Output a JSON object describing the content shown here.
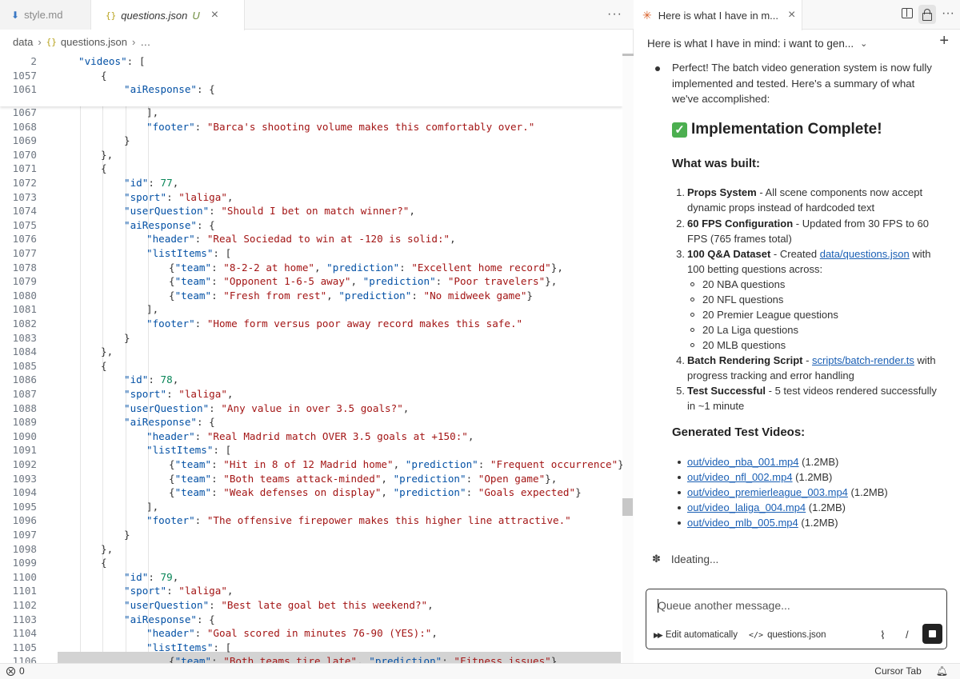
{
  "editor": {
    "tabs": [
      {
        "icon": "markdown-file-icon",
        "title": "style.md"
      },
      {
        "icon": "json-file-icon",
        "glyph": "{}",
        "title": "questions.json",
        "status": "U",
        "close": "×"
      }
    ],
    "more": "···",
    "breadcrumb": {
      "folder": "data",
      "glyph": "{}",
      "file": "questions.json",
      "tail": "…"
    },
    "sticky": [
      {
        "ln": "2",
        "parts": [
          [
            "k",
            "\"videos\""
          ],
          [
            "p",
            ": ["
          ]
        ],
        "indent": 1
      },
      {
        "ln": "1057",
        "parts": [
          [
            "p",
            "{"
          ]
        ],
        "indent": 2
      },
      {
        "ln": "1061",
        "parts": [
          [
            "k",
            "\"aiResponse\""
          ],
          [
            "p",
            ": {"
          ]
        ],
        "indent": 3
      }
    ],
    "lines": [
      {
        "ln": "1067",
        "indent": 4,
        "parts": [
          [
            "p",
            "],"
          ]
        ]
      },
      {
        "ln": "1068",
        "indent": 4,
        "parts": [
          [
            "k",
            "\"footer\""
          ],
          [
            "p",
            ": "
          ],
          [
            "s",
            "\"Barca's shooting volume makes this comfortably over.\""
          ]
        ]
      },
      {
        "ln": "1069",
        "indent": 3,
        "parts": [
          [
            "p",
            "}"
          ]
        ]
      },
      {
        "ln": "1070",
        "indent": 2,
        "parts": [
          [
            "p",
            "},"
          ]
        ]
      },
      {
        "ln": "1071",
        "indent": 2,
        "parts": [
          [
            "p",
            "{"
          ]
        ]
      },
      {
        "ln": "1072",
        "indent": 3,
        "parts": [
          [
            "k",
            "\"id\""
          ],
          [
            "p",
            ": "
          ],
          [
            "n",
            "77"
          ],
          [
            "p",
            ","
          ]
        ]
      },
      {
        "ln": "1073",
        "indent": 3,
        "parts": [
          [
            "k",
            "\"sport\""
          ],
          [
            "p",
            ": "
          ],
          [
            "s",
            "\"laliga\""
          ],
          [
            "p",
            ","
          ]
        ]
      },
      {
        "ln": "1074",
        "indent": 3,
        "parts": [
          [
            "k",
            "\"userQuestion\""
          ],
          [
            "p",
            ": "
          ],
          [
            "s",
            "\"Should I bet on match winner?\""
          ],
          [
            "p",
            ","
          ]
        ]
      },
      {
        "ln": "1075",
        "indent": 3,
        "parts": [
          [
            "k",
            "\"aiResponse\""
          ],
          [
            "p",
            ": {"
          ]
        ]
      },
      {
        "ln": "1076",
        "indent": 4,
        "parts": [
          [
            "k",
            "\"header\""
          ],
          [
            "p",
            ": "
          ],
          [
            "s",
            "\"Real Sociedad to win at -120 is solid:\""
          ],
          [
            "p",
            ","
          ]
        ]
      },
      {
        "ln": "1077",
        "indent": 4,
        "parts": [
          [
            "k",
            "\"listItems\""
          ],
          [
            "p",
            ": ["
          ]
        ]
      },
      {
        "ln": "1078",
        "indent": 5,
        "parts": [
          [
            "p",
            "{"
          ],
          [
            "k",
            "\"team\""
          ],
          [
            "p",
            ": "
          ],
          [
            "s",
            "\"8-2-2 at home\""
          ],
          [
            "p",
            ", "
          ],
          [
            "k",
            "\"prediction\""
          ],
          [
            "p",
            ": "
          ],
          [
            "s",
            "\"Excellent home record\""
          ],
          [
            "p",
            "},"
          ]
        ]
      },
      {
        "ln": "1079",
        "indent": 5,
        "parts": [
          [
            "p",
            "{"
          ],
          [
            "k",
            "\"team\""
          ],
          [
            "p",
            ": "
          ],
          [
            "s",
            "\"Opponent 1-6-5 away\""
          ],
          [
            "p",
            ", "
          ],
          [
            "k",
            "\"prediction\""
          ],
          [
            "p",
            ": "
          ],
          [
            "s",
            "\"Poor travelers\""
          ],
          [
            "p",
            "},"
          ]
        ]
      },
      {
        "ln": "1080",
        "indent": 5,
        "parts": [
          [
            "p",
            "{"
          ],
          [
            "k",
            "\"team\""
          ],
          [
            "p",
            ": "
          ],
          [
            "s",
            "\"Fresh from rest\""
          ],
          [
            "p",
            ", "
          ],
          [
            "k",
            "\"prediction\""
          ],
          [
            "p",
            ": "
          ],
          [
            "s",
            "\"No midweek game\""
          ],
          [
            "p",
            "}"
          ]
        ]
      },
      {
        "ln": "1081",
        "indent": 4,
        "parts": [
          [
            "p",
            "],"
          ]
        ]
      },
      {
        "ln": "1082",
        "indent": 4,
        "parts": [
          [
            "k",
            "\"footer\""
          ],
          [
            "p",
            ": "
          ],
          [
            "s",
            "\"Home form versus poor away record makes this safe.\""
          ]
        ]
      },
      {
        "ln": "1083",
        "indent": 3,
        "parts": [
          [
            "p",
            "}"
          ]
        ]
      },
      {
        "ln": "1084",
        "indent": 2,
        "parts": [
          [
            "p",
            "},"
          ]
        ]
      },
      {
        "ln": "1085",
        "indent": 2,
        "parts": [
          [
            "p",
            "{"
          ]
        ]
      },
      {
        "ln": "1086",
        "indent": 3,
        "parts": [
          [
            "k",
            "\"id\""
          ],
          [
            "p",
            ": "
          ],
          [
            "n",
            "78"
          ],
          [
            "p",
            ","
          ]
        ]
      },
      {
        "ln": "1087",
        "indent": 3,
        "parts": [
          [
            "k",
            "\"sport\""
          ],
          [
            "p",
            ": "
          ],
          [
            "s",
            "\"laliga\""
          ],
          [
            "p",
            ","
          ]
        ]
      },
      {
        "ln": "1088",
        "indent": 3,
        "parts": [
          [
            "k",
            "\"userQuestion\""
          ],
          [
            "p",
            ": "
          ],
          [
            "s",
            "\"Any value in over 3.5 goals?\""
          ],
          [
            "p",
            ","
          ]
        ]
      },
      {
        "ln": "1089",
        "indent": 3,
        "parts": [
          [
            "k",
            "\"aiResponse\""
          ],
          [
            "p",
            ": {"
          ]
        ]
      },
      {
        "ln": "1090",
        "indent": 4,
        "parts": [
          [
            "k",
            "\"header\""
          ],
          [
            "p",
            ": "
          ],
          [
            "s",
            "\"Real Madrid match OVER 3.5 goals at +150:\""
          ],
          [
            "p",
            ","
          ]
        ]
      },
      {
        "ln": "1091",
        "indent": 4,
        "parts": [
          [
            "k",
            "\"listItems\""
          ],
          [
            "p",
            ": ["
          ]
        ]
      },
      {
        "ln": "1092",
        "indent": 5,
        "parts": [
          [
            "p",
            "{"
          ],
          [
            "k",
            "\"team\""
          ],
          [
            "p",
            ": "
          ],
          [
            "s",
            "\"Hit in 8 of 12 Madrid home\""
          ],
          [
            "p",
            ", "
          ],
          [
            "k",
            "\"prediction\""
          ],
          [
            "p",
            ": "
          ],
          [
            "s",
            "\"Frequent occurrence\""
          ],
          [
            "p",
            "},"
          ]
        ]
      },
      {
        "ln": "1093",
        "indent": 5,
        "parts": [
          [
            "p",
            "{"
          ],
          [
            "k",
            "\"team\""
          ],
          [
            "p",
            ": "
          ],
          [
            "s",
            "\"Both teams attack-minded\""
          ],
          [
            "p",
            ", "
          ],
          [
            "k",
            "\"prediction\""
          ],
          [
            "p",
            ": "
          ],
          [
            "s",
            "\"Open game\""
          ],
          [
            "p",
            "},"
          ]
        ]
      },
      {
        "ln": "1094",
        "indent": 5,
        "parts": [
          [
            "p",
            "{"
          ],
          [
            "k",
            "\"team\""
          ],
          [
            "p",
            ": "
          ],
          [
            "s",
            "\"Weak defenses on display\""
          ],
          [
            "p",
            ", "
          ],
          [
            "k",
            "\"prediction\""
          ],
          [
            "p",
            ": "
          ],
          [
            "s",
            "\"Goals expected\""
          ],
          [
            "p",
            "}"
          ]
        ]
      },
      {
        "ln": "1095",
        "indent": 4,
        "parts": [
          [
            "p",
            "],"
          ]
        ]
      },
      {
        "ln": "1096",
        "indent": 4,
        "parts": [
          [
            "k",
            "\"footer\""
          ],
          [
            "p",
            ": "
          ],
          [
            "s",
            "\"The offensive firepower makes this higher line attractive.\""
          ]
        ]
      },
      {
        "ln": "1097",
        "indent": 3,
        "parts": [
          [
            "p",
            "}"
          ]
        ]
      },
      {
        "ln": "1098",
        "indent": 2,
        "parts": [
          [
            "p",
            "},"
          ]
        ]
      },
      {
        "ln": "1099",
        "indent": 2,
        "parts": [
          [
            "p",
            "{"
          ]
        ]
      },
      {
        "ln": "1100",
        "indent": 3,
        "parts": [
          [
            "k",
            "\"id\""
          ],
          [
            "p",
            ": "
          ],
          [
            "n",
            "79"
          ],
          [
            "p",
            ","
          ]
        ]
      },
      {
        "ln": "1101",
        "indent": 3,
        "parts": [
          [
            "k",
            "\"sport\""
          ],
          [
            "p",
            ": "
          ],
          [
            "s",
            "\"laliga\""
          ],
          [
            "p",
            ","
          ]
        ]
      },
      {
        "ln": "1102",
        "indent": 3,
        "parts": [
          [
            "k",
            "\"userQuestion\""
          ],
          [
            "p",
            ": "
          ],
          [
            "s",
            "\"Best late goal bet this weekend?\""
          ],
          [
            "p",
            ","
          ]
        ]
      },
      {
        "ln": "1103",
        "indent": 3,
        "parts": [
          [
            "k",
            "\"aiResponse\""
          ],
          [
            "p",
            ": {"
          ]
        ]
      },
      {
        "ln": "1104",
        "indent": 4,
        "parts": [
          [
            "k",
            "\"header\""
          ],
          [
            "p",
            ": "
          ],
          [
            "s",
            "\"Goal scored in minutes 76-90 (YES):\""
          ],
          [
            "p",
            ","
          ]
        ]
      },
      {
        "ln": "1105",
        "indent": 4,
        "parts": [
          [
            "k",
            "\"listItems\""
          ],
          [
            "p",
            ": ["
          ]
        ]
      },
      {
        "ln": "1106",
        "indent": 5,
        "parts": [
          [
            "p",
            "{"
          ],
          [
            "k",
            "\"team\""
          ],
          [
            "p",
            ": "
          ],
          [
            "s",
            "\"Both teams tire late\""
          ],
          [
            "p",
            ", "
          ],
          [
            "k",
            "\"prediction\""
          ],
          [
            "p",
            ": "
          ],
          [
            "s",
            "\"Fitness issues\""
          ],
          [
            "p",
            "}"
          ]
        ]
      }
    ]
  },
  "chat": {
    "tab_title": "Here is what I have in m...",
    "tab_close": "×",
    "more": "···",
    "subheader": "Here is what I have in mind: i want to gen...",
    "plus": "+",
    "intro": "Perfect! The batch video generation system is now fully implemented and tested. Here's a summary of what we've accomplished:",
    "impl_title": "Implementation Complete!",
    "built_title": "What was built:",
    "items": [
      {
        "num": "1.",
        "bold": "Props System",
        "rest": " - All scene components now accept dynamic props instead of hardcoded text"
      },
      {
        "num": "2.",
        "bold": "60 FPS Configuration",
        "rest": " - Updated from 30 FPS to 60 FPS (765 frames total)"
      },
      {
        "num": "3.",
        "bold": "100 Q&A Dataset",
        "rest": " - Created ",
        "link": "data/questions.json",
        "rest2": " with 100 betting questions across:"
      },
      {
        "num": "4.",
        "bold": "Batch Rendering Script",
        "rest": " - ",
        "link": "scripts/batch-render.ts",
        "rest2": " with progress tracking and error handling"
      },
      {
        "num": "5.",
        "bold": "Test Successful",
        "rest": " - 5 test videos rendered successfully in ~1 minute"
      }
    ],
    "sub_items": [
      "20 NBA questions",
      "20 NFL questions",
      "20 Premier League questions",
      "20 La Liga questions",
      "20 MLB questions"
    ],
    "videos_title": "Generated Test Videos:",
    "videos": [
      {
        "link": "out/video_nba_001.mp4",
        "size": " (1.2MB)"
      },
      {
        "link": "out/video_nfl_002.mp4",
        "size": " (1.2MB)"
      },
      {
        "link": "out/video_premierleague_003.mp4",
        "size": " (1.2MB)"
      },
      {
        "link": "out/video_laliga_004.mp4",
        "size": " (1.2MB)"
      },
      {
        "link": "out/video_mlb_005.mp4",
        "size": " (1.2MB)"
      }
    ],
    "ideating": "Ideating...",
    "composer": {
      "placeholder": "Queue another message...",
      "auto_label": "Edit automatically",
      "context_file": "questions.json",
      "slash": "/"
    }
  },
  "status": {
    "errors": "0",
    "right_label": "Cursor Tab"
  }
}
